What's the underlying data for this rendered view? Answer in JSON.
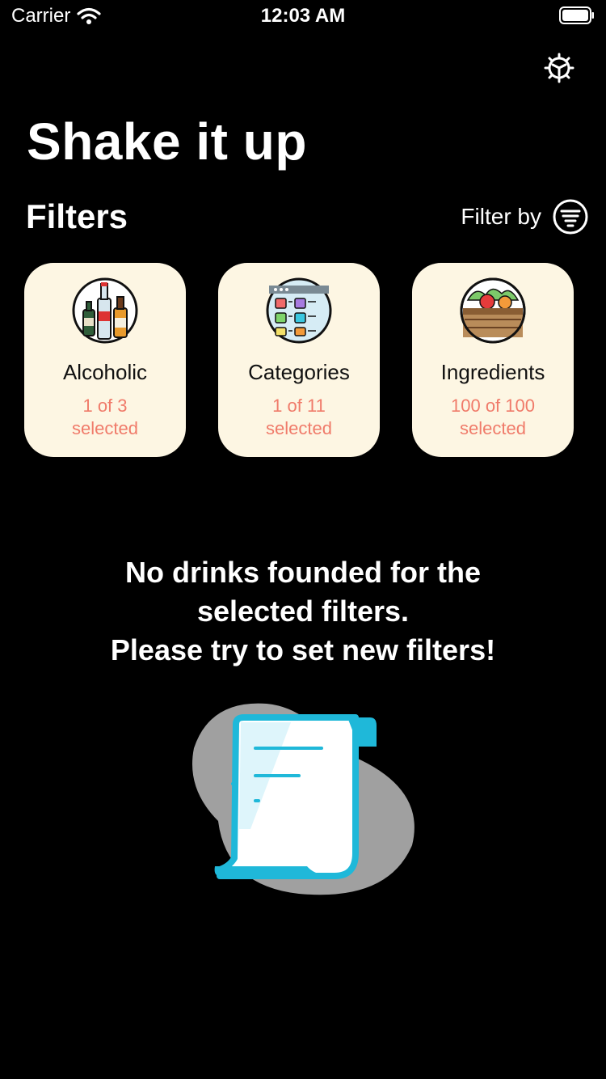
{
  "status_bar": {
    "carrier": "Carrier",
    "time": "12:03 AM"
  },
  "header": {
    "title": "Shake it up",
    "settings_icon": "gear-icon"
  },
  "filters": {
    "section_title": "Filters",
    "filter_by_label": "Filter by",
    "filter_by_icon": "filter-lines-icon",
    "cards": [
      {
        "title": "Alcoholic",
        "count": "1 of 3",
        "suffix": "selected",
        "icon": "bottles-icon"
      },
      {
        "title": "Categories",
        "count": "1 of 11",
        "suffix": "selected",
        "icon": "categories-grid-icon"
      },
      {
        "title": "Ingredients",
        "count": "100 of 100",
        "suffix": "selected",
        "icon": "vegetable-crate-icon"
      }
    ]
  },
  "empty_state": {
    "line1": "No drinks founded for the",
    "line2": "selected filters.",
    "line3": "Please try to set new filters!",
    "illustration": "scroll-icon"
  },
  "colors": {
    "background": "#000000",
    "card_background": "#fdf6e3",
    "count_text": "#f07b6a",
    "scroll_accent": "#1fb8d9",
    "blob": "#a0a0a0"
  }
}
